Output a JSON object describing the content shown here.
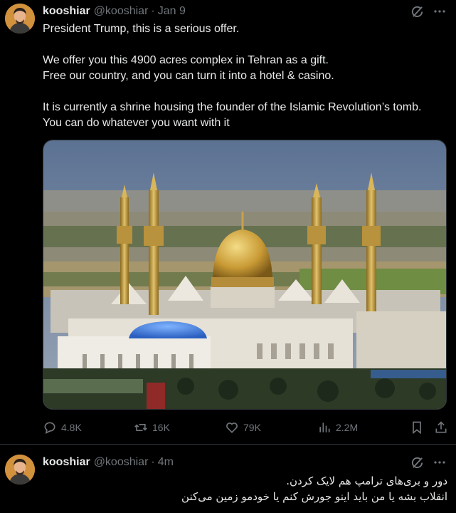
{
  "tweets": [
    {
      "author_name": "kooshiar",
      "handle": "@kooshiar",
      "separator": "·",
      "time": "Jan 9",
      "lines": [
        "President Trump, this is a serious offer.",
        "",
        "We offer you this 4900 acres complex in Tehran as a gift.",
        "Free our country, and you can turn it into a hotel & casino.",
        "",
        "It is currently a shrine housing the founder of the Islamic Revolution’s tomb.",
        "You can do whatever you want with it"
      ],
      "media": {
        "subject": "photo-golden-dome-shrine-with-minarets"
      },
      "stats": {
        "replies": "4.8K",
        "reposts": "16K",
        "likes": "79K",
        "views": "2.2M"
      }
    },
    {
      "author_name": "kooshiar",
      "handle": "@kooshiar",
      "separator": "·",
      "time": "4m",
      "lines": [
        "دور و بری‌های ترامپ هم لایک کردن.",
        "انقلاب بشه یا من باید اینو جورش کنم یا خودمو زمین می‌کنن"
      ]
    }
  ],
  "icons": {
    "grok": "grok-icon",
    "more": "more-icon",
    "reply": "reply-icon",
    "repost": "repost-icon",
    "like": "like-icon",
    "views": "views-icon",
    "bookmark": "bookmark-icon",
    "share": "share-icon"
  },
  "colors": {
    "background": "#000000",
    "text": "#e7e9ea",
    "muted": "#71767b",
    "divider": "#2f3336"
  }
}
